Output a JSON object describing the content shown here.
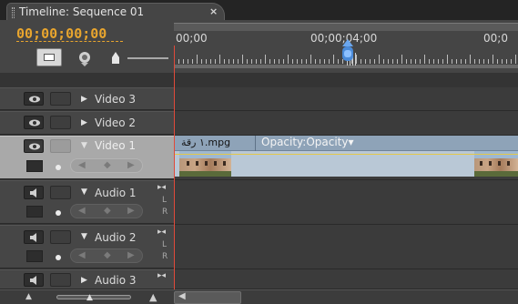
{
  "tab": {
    "title": "Timeline: Sequence 01",
    "close": "×"
  },
  "header": {
    "timecode": "00;00;00;00",
    "icons": {
      "snap": "snap-icon",
      "marker": "set-marker-icon",
      "keyframe": "keyframe-icon"
    }
  },
  "ruler": {
    "labels": [
      "00;00",
      "00;00;04;00",
      "00;0"
    ]
  },
  "tracks": {
    "video3": {
      "name": "Video 3"
    },
    "video2": {
      "name": "Video 2"
    },
    "video1": {
      "name": "Video 1"
    },
    "audio1": {
      "name": "Audio 1"
    },
    "audio2": {
      "name": "Audio 2"
    },
    "audio3": {
      "name": "Audio 3"
    }
  },
  "lr": {
    "l": "L",
    "r": "R"
  },
  "clip": {
    "name": "١ رقة.mpg",
    "effect": "Opacity:Opacity"
  },
  "bottom": {
    "zoom_out": "▲",
    "zoom_in": "▲"
  },
  "colors": {
    "timecode": "#e8a52e",
    "playhead": "#e04a3a",
    "clip": "#8ea3b8",
    "selected_track": "#a9a9a9"
  }
}
